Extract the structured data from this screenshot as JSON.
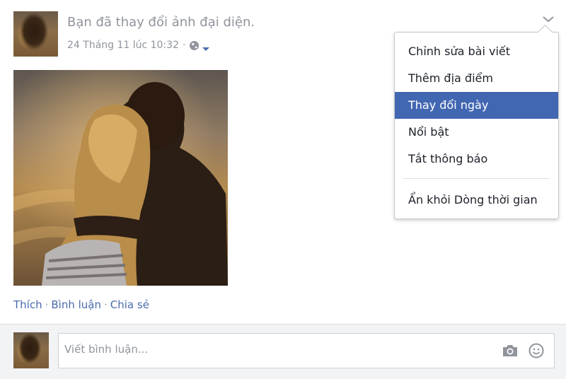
{
  "post": {
    "story": "Bạn đã thay đổi ảnh đại diện.",
    "timestamp": "24 Tháng 11 lúc 10:32",
    "separator": "·",
    "privacy_icon": "globe-icon",
    "menu_toggle_icon": "chevron-down-icon"
  },
  "actions": {
    "like": "Thích",
    "comment": "Bình luận",
    "share": "Chia sẻ",
    "dot": "·"
  },
  "menu": {
    "items": [
      {
        "label": "Chỉnh sửa bài viết"
      },
      {
        "label": "Thêm địa điểm"
      },
      {
        "label": "Thay đổi ngày",
        "highlighted": true
      },
      {
        "label": "Nổi bật"
      },
      {
        "label": "Tắt thông báo"
      },
      {
        "label": "Ẩn khỏi Dòng thời gian"
      }
    ]
  },
  "composer": {
    "placeholder": "Viết bình luận...",
    "photo_icon": "camera-icon",
    "sticker_icon": "emoji-icon"
  },
  "colors": {
    "link": "#4b6cad",
    "highlight": "#4267b2",
    "muted_text": "#90949c"
  }
}
